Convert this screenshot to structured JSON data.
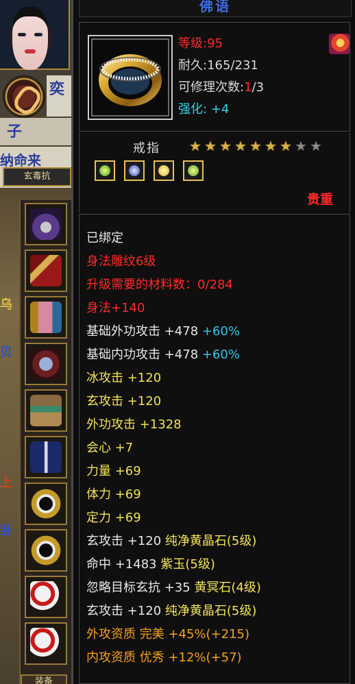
{
  "left_panel": {
    "map_text_1": "奕",
    "map_text_2": "子",
    "map_text_3": "纳命来",
    "tag_label": "玄毒抗",
    "bottom_tab": "装备",
    "side_marks": [
      "乌",
      "贝",
      "上",
      "卧"
    ]
  },
  "tooltip": {
    "title": "佛语",
    "level_label": "等级",
    "level_sep": ":",
    "level_value": "95",
    "durability_label": "耐久",
    "durability_sep": ":",
    "durability_value": "165/231",
    "repair_label": "可修理次数",
    "repair_sep": ":",
    "repair_current": "1",
    "repair_total": "/3",
    "enhance_label": "强化",
    "enhance_sep": ": ",
    "enhance_value": "+4",
    "item_type": "戒指",
    "stars_total": 9,
    "stars_on": 7,
    "gems": [
      "green-gem-icon",
      "blue-gem-icon",
      "yellow-gem-icon",
      "green-gem-icon"
    ],
    "grade": "贵重"
  },
  "attributes": [
    {
      "parts": [
        {
          "text": "已绑定",
          "color": "white"
        }
      ]
    },
    {
      "parts": [
        {
          "text": "身法雕纹6级",
          "color": "red"
        }
      ]
    },
    {
      "parts": [
        {
          "text": "升级需要的材料数：0/284",
          "color": "red"
        }
      ]
    },
    {
      "parts": [
        {
          "text": "身法+140",
          "color": "red"
        }
      ]
    },
    {
      "parts": [
        {
          "text": "基础外功攻击 +478 ",
          "color": "white"
        },
        {
          "text": "+60%",
          "color": "cyan"
        }
      ]
    },
    {
      "parts": [
        {
          "text": "基础内功攻击 +478 ",
          "color": "white"
        },
        {
          "text": "+60%",
          "color": "cyan"
        }
      ]
    },
    {
      "parts": [
        {
          "text": "冰攻击 +120",
          "color": "yellow"
        }
      ]
    },
    {
      "parts": [
        {
          "text": "玄攻击 +120",
          "color": "yellow"
        }
      ]
    },
    {
      "parts": [
        {
          "text": "外功攻击 +1328",
          "color": "yellow"
        }
      ]
    },
    {
      "parts": [
        {
          "text": "会心 +7",
          "color": "yellow"
        }
      ]
    },
    {
      "parts": [
        {
          "text": "力量 +69",
          "color": "yellow"
        }
      ]
    },
    {
      "parts": [
        {
          "text": "体力 +69",
          "color": "yellow"
        }
      ]
    },
    {
      "parts": [
        {
          "text": "定力 +69",
          "color": "yellow"
        }
      ]
    },
    {
      "parts": [
        {
          "text": "玄攻击 +120 ",
          "color": "white"
        },
        {
          "text": "纯净黄晶石(5级)",
          "color": "yellow"
        }
      ]
    },
    {
      "parts": [
        {
          "text": "命中 +1483 ",
          "color": "white"
        },
        {
          "text": "紫玉(5级)",
          "color": "yellow"
        }
      ]
    },
    {
      "parts": [
        {
          "text": "忽略目标玄抗 +35 ",
          "color": "white"
        },
        {
          "text": "黄冥石(4级)",
          "color": "yellow"
        }
      ]
    },
    {
      "parts": [
        {
          "text": "玄攻击 +120 ",
          "color": "white"
        },
        {
          "text": "纯净黄晶石(5级)",
          "color": "yellow"
        }
      ]
    },
    {
      "parts": [
        {
          "text": "外攻资质  完美 +45%(+215)",
          "color": "orange"
        }
      ]
    },
    {
      "parts": [
        {
          "text": "内攻资质  优秀 +12%(+57)",
          "color": "orange"
        }
      ]
    }
  ],
  "equipment_slots": [
    "amulet-icon",
    "scroll-icon",
    "bracer-icon",
    "gauntlet-icon",
    "belt-icon",
    "boots-icon",
    "ring-icon",
    "ring-icon",
    "charm-icon",
    "charm-icon"
  ],
  "colors": {
    "title": "#3f6ae0",
    "red": "#ff2a2a",
    "cyan": "#35c8e6",
    "yellow": "#f2e45a",
    "orange": "#f4a11e",
    "star_gold": "#d8b24a"
  }
}
